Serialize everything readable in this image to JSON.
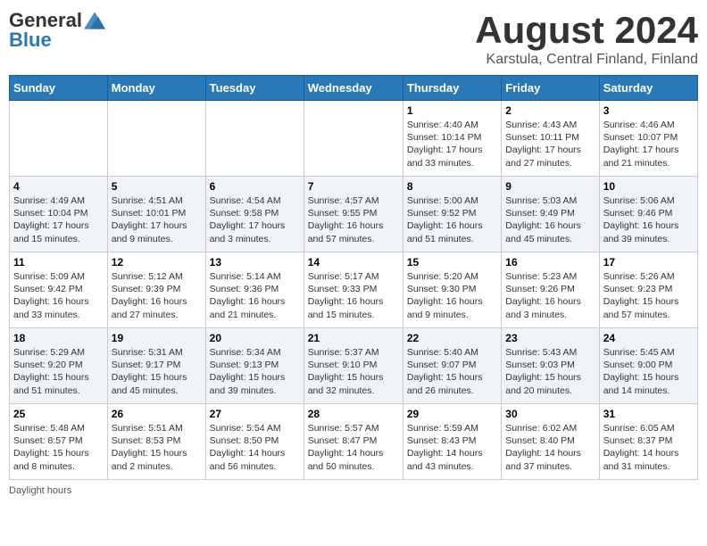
{
  "header": {
    "logo_general": "General",
    "logo_blue": "Blue",
    "main_title": "August 2024",
    "subtitle": "Karstula, Central Finland, Finland"
  },
  "days_of_week": [
    "Sunday",
    "Monday",
    "Tuesday",
    "Wednesday",
    "Thursday",
    "Friday",
    "Saturday"
  ],
  "weeks": [
    [
      {
        "day": "",
        "info": ""
      },
      {
        "day": "",
        "info": ""
      },
      {
        "day": "",
        "info": ""
      },
      {
        "day": "",
        "info": ""
      },
      {
        "day": "1",
        "info": "Sunrise: 4:40 AM\nSunset: 10:14 PM\nDaylight: 17 hours\nand 33 minutes."
      },
      {
        "day": "2",
        "info": "Sunrise: 4:43 AM\nSunset: 10:11 PM\nDaylight: 17 hours\nand 27 minutes."
      },
      {
        "day": "3",
        "info": "Sunrise: 4:46 AM\nSunset: 10:07 PM\nDaylight: 17 hours\nand 21 minutes."
      }
    ],
    [
      {
        "day": "4",
        "info": "Sunrise: 4:49 AM\nSunset: 10:04 PM\nDaylight: 17 hours\nand 15 minutes."
      },
      {
        "day": "5",
        "info": "Sunrise: 4:51 AM\nSunset: 10:01 PM\nDaylight: 17 hours\nand 9 minutes."
      },
      {
        "day": "6",
        "info": "Sunrise: 4:54 AM\nSunset: 9:58 PM\nDaylight: 17 hours\nand 3 minutes."
      },
      {
        "day": "7",
        "info": "Sunrise: 4:57 AM\nSunset: 9:55 PM\nDaylight: 16 hours\nand 57 minutes."
      },
      {
        "day": "8",
        "info": "Sunrise: 5:00 AM\nSunset: 9:52 PM\nDaylight: 16 hours\nand 51 minutes."
      },
      {
        "day": "9",
        "info": "Sunrise: 5:03 AM\nSunset: 9:49 PM\nDaylight: 16 hours\nand 45 minutes."
      },
      {
        "day": "10",
        "info": "Sunrise: 5:06 AM\nSunset: 9:46 PM\nDaylight: 16 hours\nand 39 minutes."
      }
    ],
    [
      {
        "day": "11",
        "info": "Sunrise: 5:09 AM\nSunset: 9:42 PM\nDaylight: 16 hours\nand 33 minutes."
      },
      {
        "day": "12",
        "info": "Sunrise: 5:12 AM\nSunset: 9:39 PM\nDaylight: 16 hours\nand 27 minutes."
      },
      {
        "day": "13",
        "info": "Sunrise: 5:14 AM\nSunset: 9:36 PM\nDaylight: 16 hours\nand 21 minutes."
      },
      {
        "day": "14",
        "info": "Sunrise: 5:17 AM\nSunset: 9:33 PM\nDaylight: 16 hours\nand 15 minutes."
      },
      {
        "day": "15",
        "info": "Sunrise: 5:20 AM\nSunset: 9:30 PM\nDaylight: 16 hours\nand 9 minutes."
      },
      {
        "day": "16",
        "info": "Sunrise: 5:23 AM\nSunset: 9:26 PM\nDaylight: 16 hours\nand 3 minutes."
      },
      {
        "day": "17",
        "info": "Sunrise: 5:26 AM\nSunset: 9:23 PM\nDaylight: 15 hours\nand 57 minutes."
      }
    ],
    [
      {
        "day": "18",
        "info": "Sunrise: 5:29 AM\nSunset: 9:20 PM\nDaylight: 15 hours\nand 51 minutes."
      },
      {
        "day": "19",
        "info": "Sunrise: 5:31 AM\nSunset: 9:17 PM\nDaylight: 15 hours\nand 45 minutes."
      },
      {
        "day": "20",
        "info": "Sunrise: 5:34 AM\nSunset: 9:13 PM\nDaylight: 15 hours\nand 39 minutes."
      },
      {
        "day": "21",
        "info": "Sunrise: 5:37 AM\nSunset: 9:10 PM\nDaylight: 15 hours\nand 32 minutes."
      },
      {
        "day": "22",
        "info": "Sunrise: 5:40 AM\nSunset: 9:07 PM\nDaylight: 15 hours\nand 26 minutes."
      },
      {
        "day": "23",
        "info": "Sunrise: 5:43 AM\nSunset: 9:03 PM\nDaylight: 15 hours\nand 20 minutes."
      },
      {
        "day": "24",
        "info": "Sunrise: 5:45 AM\nSunset: 9:00 PM\nDaylight: 15 hours\nand 14 minutes."
      }
    ],
    [
      {
        "day": "25",
        "info": "Sunrise: 5:48 AM\nSunset: 8:57 PM\nDaylight: 15 hours\nand 8 minutes."
      },
      {
        "day": "26",
        "info": "Sunrise: 5:51 AM\nSunset: 8:53 PM\nDaylight: 15 hours\nand 2 minutes."
      },
      {
        "day": "27",
        "info": "Sunrise: 5:54 AM\nSunset: 8:50 PM\nDaylight: 14 hours\nand 56 minutes."
      },
      {
        "day": "28",
        "info": "Sunrise: 5:57 AM\nSunset: 8:47 PM\nDaylight: 14 hours\nand 50 minutes."
      },
      {
        "day": "29",
        "info": "Sunrise: 5:59 AM\nSunset: 8:43 PM\nDaylight: 14 hours\nand 43 minutes."
      },
      {
        "day": "30",
        "info": "Sunrise: 6:02 AM\nSunset: 8:40 PM\nDaylight: 14 hours\nand 37 minutes."
      },
      {
        "day": "31",
        "info": "Sunrise: 6:05 AM\nSunset: 8:37 PM\nDaylight: 14 hours\nand 31 minutes."
      }
    ]
  ],
  "footer": {
    "daylight_hours_label": "Daylight hours"
  }
}
